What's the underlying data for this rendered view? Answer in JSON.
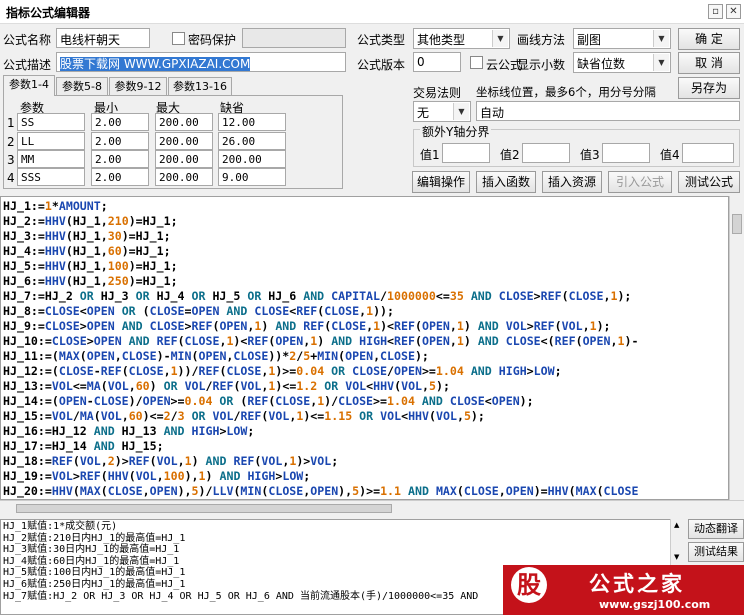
{
  "window": {
    "title": "指标公式编辑器",
    "close_glyph": "✕"
  },
  "form": {
    "name_label": "公式名称",
    "name_value": "电线杆朝天",
    "password_label": "密码保护",
    "type_label": "公式类型",
    "type_value": "其他类型",
    "draw_label": "画线方法",
    "draw_value": "副图",
    "desc_label": "公式描述",
    "desc_value": "股票下载网 WWW.GPXIAZAI.COM",
    "version_label": "公式版本",
    "version_value": "0",
    "cloud_label": "云公式",
    "decimals_label": "显示小数",
    "decimals_value": "缺省位数"
  },
  "buttons": {
    "ok": "确 定",
    "cancel": "取 消",
    "save_as": "另存为",
    "edit_ops": "编辑操作",
    "insert_fn": "插入函数",
    "insert_res": "插入资源",
    "import": "引入公式",
    "test": "测试公式"
  },
  "tabs": [
    "参数1-4",
    "参数5-8",
    "参数9-12",
    "参数13-16"
  ],
  "params": {
    "headers": [
      "参数",
      "最小",
      "最大",
      "缺省"
    ],
    "rows": [
      {
        "idx": "1",
        "name": "SS",
        "min": "2.00",
        "max": "200.00",
        "def": "12.00"
      },
      {
        "idx": "2",
        "name": "LL",
        "min": "2.00",
        "max": "200.00",
        "def": "26.00"
      },
      {
        "idx": "3",
        "name": "MM",
        "min": "2.00",
        "max": "200.00",
        "def": "200.00"
      },
      {
        "idx": "4",
        "name": "SSS",
        "min": "2.00",
        "max": "200.00",
        "def": "9.00"
      }
    ]
  },
  "rule": {
    "label": "交易法则",
    "value": "无",
    "coord_label": "坐标线位置，最多6个，用分号分隔",
    "coord_value": "自动",
    "yaxis_label": "额外Y轴分界",
    "values": [
      "值1",
      "值2",
      "值3",
      "值4"
    ]
  },
  "code": [
    "HJ_1:=1*AMOUNT;",
    "HJ_2:=HHV(HJ_1,210)=HJ_1;",
    "HJ_3:=HHV(HJ_1,30)=HJ_1;",
    "HJ_4:=HHV(HJ_1,60)=HJ_1;",
    "HJ_5:=HHV(HJ_1,100)=HJ_1;",
    "HJ_6:=HHV(HJ_1,250)=HJ_1;",
    "HJ_7:=HJ_2 OR HJ_3 OR HJ_4 OR HJ_5 OR HJ_6 AND CAPITAL/1000000<=35 AND CLOSE>REF(CLOSE,1);",
    "HJ_8:=CLOSE<OPEN OR (CLOSE=OPEN AND CLOSE<REF(CLOSE,1));",
    "HJ_9:=CLOSE>OPEN AND CLOSE>REF(OPEN,1) AND REF(CLOSE,1)<REF(OPEN,1) AND VOL>REF(VOL,1);",
    "HJ_10:=CLOSE>OPEN AND REF(CLOSE,1)<REF(OPEN,1) AND HIGH<REF(OPEN,1) AND CLOSE<(REF(OPEN,1)-",
    "HJ_11:=(MAX(OPEN,CLOSE)-MIN(OPEN,CLOSE))*2/5+MIN(OPEN,CLOSE);",
    "HJ_12:=(CLOSE-REF(CLOSE,1))/REF(CLOSE,1)>=0.04 OR CLOSE/OPEN>=1.04 AND HIGH>LOW;",
    "HJ_13:=VOL<=MA(VOL,60) OR VOL/REF(VOL,1)<=1.2 OR VOL<HHV(VOL,5);",
    "HJ_14:=(OPEN-CLOSE)/OPEN>=0.04 OR (REF(CLOSE,1)/CLOSE>=1.04 AND CLOSE<OPEN);",
    "HJ_15:=VOL/MA(VOL,60)<=2/3 OR VOL/REF(VOL,1)<=1.15 OR VOL<HHV(VOL,5);",
    "HJ_16:=HJ_12 AND HJ_13 AND HIGH>LOW;",
    "HJ_17:=HJ_14 AND HJ_15;",
    "HJ_18:=REF(VOL,2)>REF(VOL,1) AND REF(VOL,1)>VOL;",
    "HJ_19:=VOL>REF(HHV(VOL,100),1) AND HIGH>LOW;",
    "HJ_20:=HHV(MAX(CLOSE,OPEN),5)/LLV(MIN(CLOSE,OPEN),5)>=1.1 AND MAX(CLOSE,OPEN)=HHV(MAX(CLOSE"
  ],
  "explain": [
    "HJ_1赋值:1*成交额(元)",
    "HJ_2赋值:210日内HJ_1的最高值=HJ_1",
    "HJ_3赋值:30日内HJ_1的最高值=HJ_1",
    "HJ_4赋值:60日内HJ_1的最高值=HJ_1",
    "HJ_5赋值:100日内HJ_1的最高值=HJ_1",
    "HJ_6赋值:250日内HJ_1的最高值=HJ_1",
    "HJ_7赋值:HJ_2 OR HJ_3 OR HJ_4 OR HJ_5 OR HJ_6 AND 当前流通股本(手)/1000000<=35 AND"
  ],
  "side": {
    "dynamic": "动态翻译",
    "result": "测试结果"
  },
  "logo": {
    "glyph": "股",
    "text": "公式之家",
    "url": "www.gszj100.com"
  },
  "colors": {
    "number": "#d97000",
    "function": "#1a47b0",
    "keyword": "#0b6e8a",
    "selection": "#3278d2"
  }
}
